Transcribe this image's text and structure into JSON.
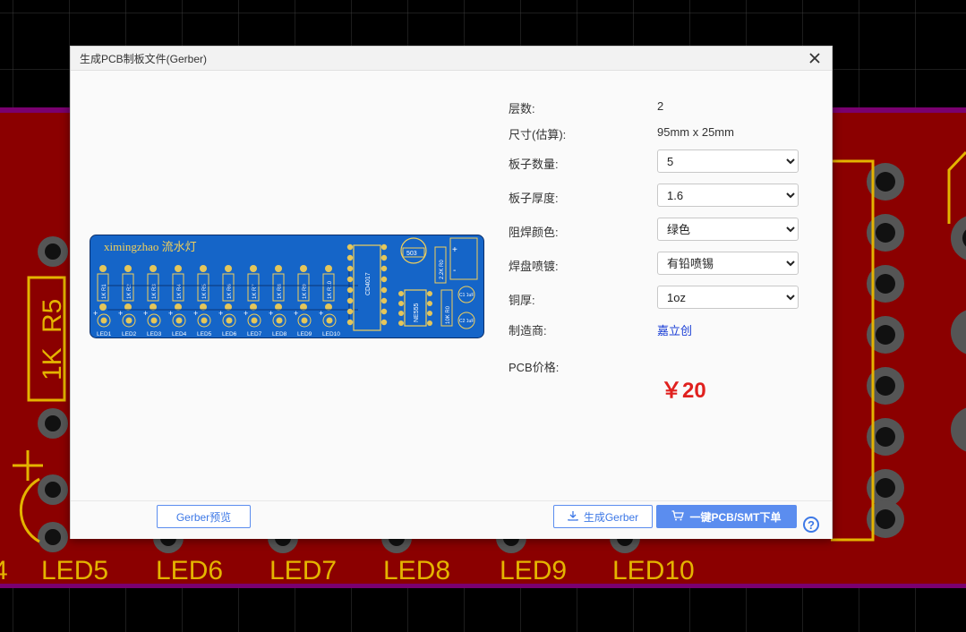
{
  "background": {
    "silkscreen_labels": [
      "4",
      "LED5",
      "LED6",
      "LED7",
      "LED8",
      "LED9",
      "LED10"
    ],
    "component_labels": [
      "R5",
      "1K"
    ]
  },
  "dialog": {
    "title": "生成PCB制板文件(Gerber)",
    "pcb_preview": {
      "board_title": "ximingzhao 流水灯",
      "resistor_labels": [
        "1K R1",
        "1K R2",
        "1K R3",
        "1K R4",
        "1K R5",
        "1K R6",
        "1K R7",
        "1K R8",
        "1K R9",
        "1K R10"
      ],
      "led_labels": [
        "LED1",
        "LED2",
        "LED3",
        "LED4",
        "LED5",
        "LED6",
        "LED7",
        "LED8",
        "LED9",
        "LED10"
      ],
      "ic1": "CD4017",
      "ic2": "NE555",
      "pot": "503",
      "r_a": "2.2K R0",
      "r_b": "10K R0",
      "cap1": "C1 1uF",
      "cap2": "C2 1uF"
    },
    "specs": {
      "layers_label": "层数:",
      "layers_value": "2",
      "size_label": "尺寸(估算):",
      "size_value": "95mm x 25mm",
      "qty_label": "板子数量:",
      "qty_value": "5",
      "thickness_label": "板子厚度:",
      "thickness_value": "1.6",
      "mask_label": "阻焊颜色:",
      "mask_value": "绿色",
      "finish_label": "焊盘喷镀:",
      "finish_value": "有铅喷锡",
      "copper_label": "铜厚:",
      "copper_value": "1oz",
      "mfr_label": "制造商:",
      "mfr_value": "嘉立创",
      "price_label": "PCB价格:",
      "price_value": "￥20"
    },
    "footer": {
      "preview_button": "Gerber预览",
      "generate_button": "生成Gerber",
      "order_button": "一键PCB/SMT下单",
      "help": "?"
    }
  },
  "colors": {
    "pcb_bg": "#8b0000",
    "pcb_board": "#1565c8",
    "silk": "#e4b400",
    "accent": "#5b8def",
    "price": "#e0201e"
  }
}
